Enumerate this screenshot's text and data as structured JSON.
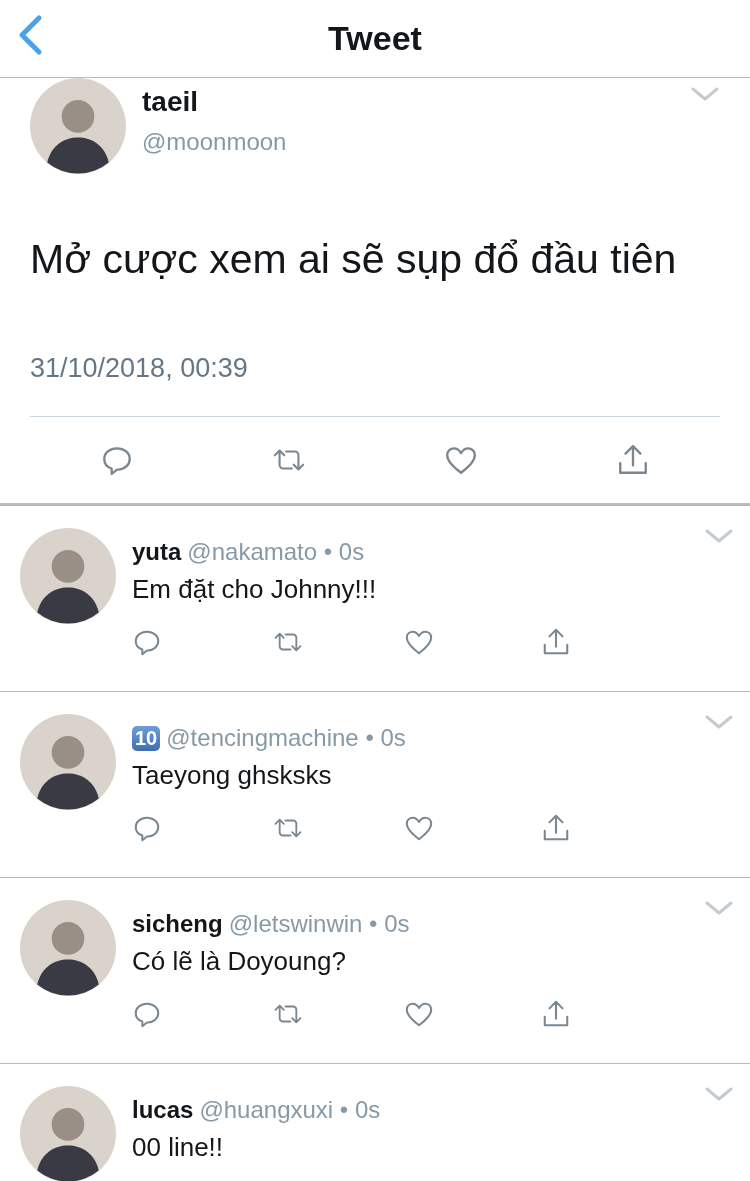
{
  "header": {
    "title": "Tweet"
  },
  "tweet": {
    "name": "taeil",
    "handle": "@moonmoon",
    "text": "Mở cược xem ai sẽ sụp đổ đầu tiên",
    "timestamp": "31/10/2018, 00:39"
  },
  "replies": [
    {
      "kind": "text",
      "name": "yuta",
      "meta": "@nakamato • 0s",
      "text": "Em đặt cho Johnny!!!",
      "actions": [
        {
          "kind": "reply"
        },
        {
          "kind": "retweet"
        },
        {
          "kind": "like"
        },
        {
          "kind": "share"
        }
      ]
    },
    {
      "kind": "keycap",
      "name": "10",
      "meta": "@tencingmachine • 0s",
      "text": "Taeyong ghsksks",
      "actions": [
        {
          "kind": "reply"
        },
        {
          "kind": "retweet"
        },
        {
          "kind": "like"
        },
        {
          "kind": "share"
        }
      ]
    },
    {
      "kind": "text",
      "name": "sicheng",
      "meta": "@letswinwin • 0s",
      "text": "Có lẽ là Doyoung?",
      "actions": [
        {
          "kind": "reply"
        },
        {
          "kind": "retweet"
        },
        {
          "kind": "like"
        },
        {
          "kind": "share"
        }
      ]
    },
    {
      "kind": "text",
      "name": "lucas",
      "meta": "@huangxuxi • 0s",
      "text": "00 line!!"
    }
  ]
}
